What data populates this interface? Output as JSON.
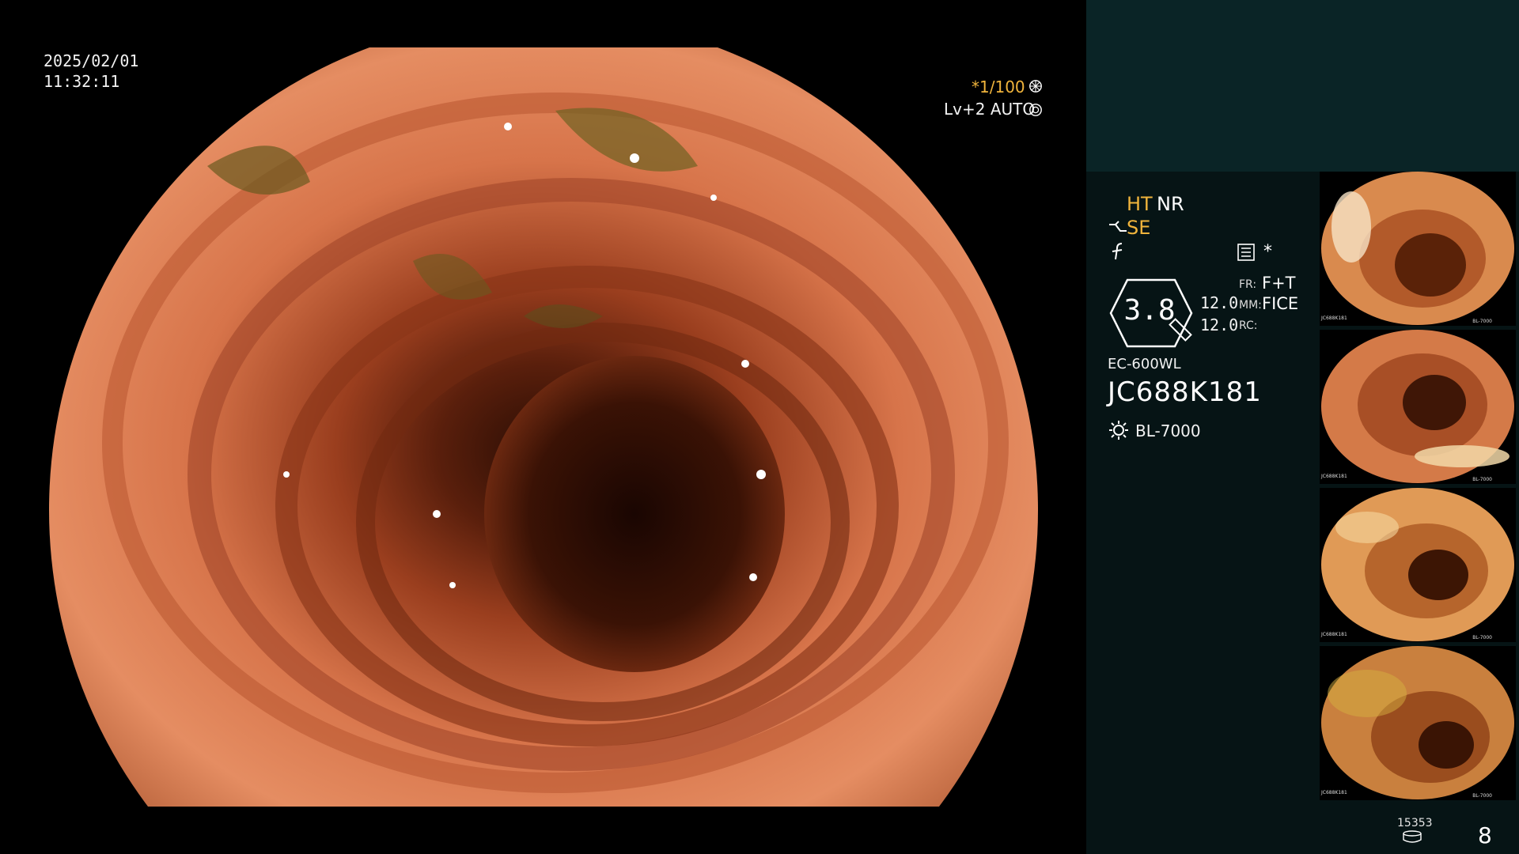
{
  "main_view": {
    "date": "2025/02/01",
    "time": "11:32:11",
    "shutter": "*1/100",
    "level": "Lv+2 AUTO"
  },
  "panel": {
    "ht": "HT",
    "nr": "NR",
    "se": "SE",
    "star": "*",
    "dial_value": "3.8",
    "value_1": "12.0",
    "value_2": "12.0",
    "fr_label": "FR:",
    "fr_value": "F+T",
    "mm_label": "MM:",
    "mm_value": "FICE",
    "rc_label": "RC:",
    "scope_model": "EC-600WL",
    "serial": "JC688K181",
    "lamp": "BL-7000"
  },
  "thumbnails": [
    {
      "cap": "JC688K181",
      "cap2": "BL-7000"
    },
    {
      "cap": "JC688K181",
      "cap2": "BL-7000"
    },
    {
      "cap": "JC688K181",
      "cap2": "BL-7000"
    },
    {
      "cap": "JC688K181",
      "cap2": "BL-7000"
    }
  ],
  "footer": {
    "image_count": "15353",
    "page": "8"
  },
  "colors": {
    "accent": "#f0b43c",
    "panel_bg": "#061415",
    "panel_top_bg": "#0a2426"
  },
  "icons": [
    "shutter-icon",
    "auto-icon",
    "structure-enhance-icon",
    "f-icon",
    "list-icon",
    "lamp-icon",
    "disk-icon"
  ]
}
